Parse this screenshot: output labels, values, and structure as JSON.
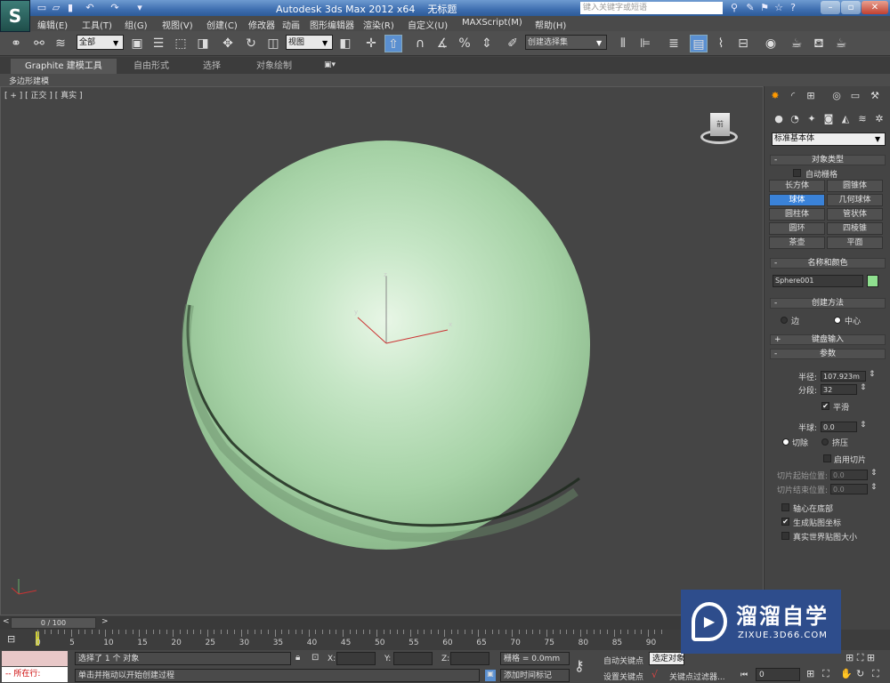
{
  "app": {
    "title": "Autodesk 3ds Max  2012 x64",
    "doc": "无标题",
    "search_placeholder": "键入关键字或短语",
    "logo": "S"
  },
  "menu": [
    "编辑(E)",
    "工具(T)",
    "组(G)",
    "视图(V)",
    "创建(C)",
    "修改器",
    "动画",
    "图形编辑器",
    "渲染(R)",
    "自定义(U)",
    "MAXScript(M)",
    "帮助(H)"
  ],
  "toolbar": {
    "selection_filter": "全部",
    "ref_coord": "视图",
    "named_selection": "创建选择集"
  },
  "ribbon": {
    "tabs": [
      "Graphite 建模工具",
      "自由形式",
      "选择",
      "对象绘制"
    ],
    "sub": "多边形建模"
  },
  "viewport": {
    "label": "[ + ] [ 正交 ] [ 真实 ]",
    "axes": {
      "x": "x",
      "y": "y",
      "z": "z"
    },
    "cube": "前"
  },
  "panel": {
    "category": "标准基本体",
    "object_type": {
      "title": "对象类型",
      "auto_grid": "自动栅格",
      "buttons": [
        "长方体",
        "圆锥体",
        "球体",
        "几何球体",
        "圆柱体",
        "管状体",
        "圆环",
        "四棱锥",
        "茶壶",
        "平面"
      ],
      "active": "球体"
    },
    "name_color": {
      "title": "名称和颜色",
      "name": "Sphere001",
      "color": "#8fe08f"
    },
    "creation": {
      "title": "创建方法",
      "edge": "边",
      "center": "中心",
      "selected": "中心"
    },
    "keyboard": {
      "title": "键盘输入"
    },
    "params": {
      "title": "参数",
      "radius_label": "半径:",
      "radius": "107.923m",
      "segments_label": "分段:",
      "segments": "32",
      "smooth": "平滑",
      "smooth_checked": true,
      "hemisphere_label": "半球:",
      "hemisphere": "0.0",
      "chop": "切除",
      "squash": "挤压",
      "chop_selected": true,
      "slice_on": "启用切片",
      "slice_from_label": "切片起始位置:",
      "slice_from": "0.0",
      "slice_to_label": "切片结束位置:",
      "slice_to": "0.0",
      "base_pivot": "轴心在底部",
      "gen_map": "生成贴图坐标",
      "gen_map_checked": true,
      "real_world": "真实世界贴图大小"
    }
  },
  "timeline": {
    "frame": "0 / 100",
    "ticks": [
      "0",
      "5",
      "10",
      "15",
      "20",
      "25",
      "30",
      "35",
      "40",
      "45",
      "50",
      "55",
      "60",
      "65",
      "70",
      "75",
      "80",
      "85",
      "90"
    ]
  },
  "status": {
    "selected": "选择了 1 个 对象",
    "prompt": "单击并拖动以开始创建过程",
    "x_label": "X:",
    "y_label": "Y:",
    "z_label": "Z:",
    "grid": "栅格 = 0.0mm",
    "add_time_tag": "添加时间标记",
    "auto_key": "自动关键点",
    "selected_obj": "选定对象",
    "set_key": "设置关键点",
    "key_filters": "关键点过滤器...",
    "frame_value": "0",
    "script_line": "-- 所在行:"
  },
  "watermark": {
    "name": "溜溜自学",
    "url": "ZIXUE.3D66.COM"
  }
}
